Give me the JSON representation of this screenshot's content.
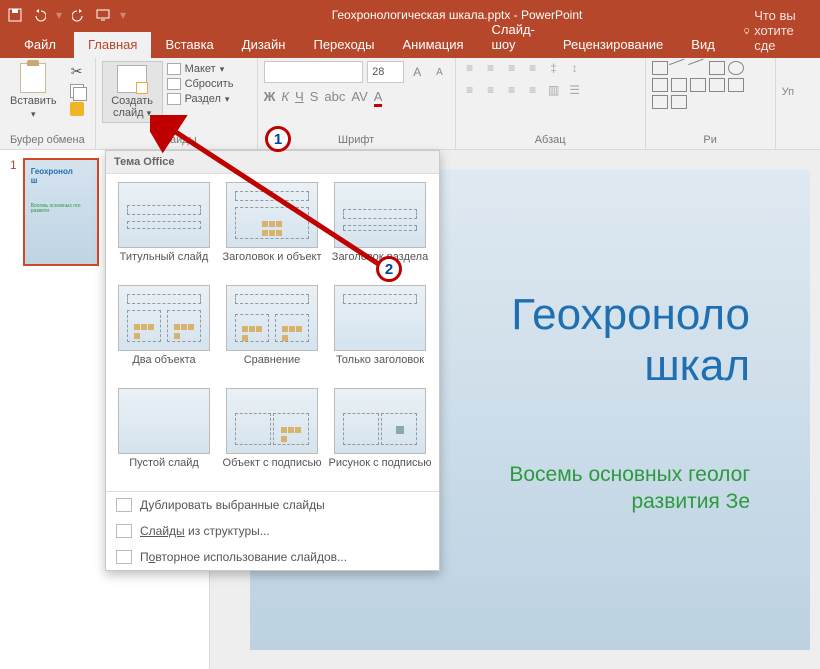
{
  "titlebar": {
    "title": "Геохронологическая шкала.pptx - PowerPoint"
  },
  "tabs": {
    "file": "Файл",
    "home": "Главная",
    "insert": "Вставка",
    "design": "Дизайн",
    "transitions": "Переходы",
    "animations": "Анимация",
    "slideshow": "Слайд-шоу",
    "review": "Рецензирование",
    "view": "Вид",
    "tellme": "Что вы хотите сде"
  },
  "ribbon": {
    "clipboard": {
      "paste": "Вставить",
      "label": "Буфер обмена"
    },
    "slides": {
      "new": "Создать\nслайд",
      "layout": "Макет",
      "reset": "Сбросить",
      "section": "Раздел",
      "label": "Слайды"
    },
    "font": {
      "size": "28",
      "label": "Шрифт",
      "b": "Ж",
      "i": "К",
      "u": "Ч",
      "s": "S"
    },
    "paragraph": {
      "label": "Абзац"
    },
    "drawing": {
      "label": "Ри"
    }
  },
  "gallery": {
    "header": "Тема Office",
    "items": [
      "Титульный слайд",
      "Заголовок и объект",
      "Заголовок раздела",
      "Два объекта",
      "Сравнение",
      "Только заголовок",
      "Пустой слайд",
      "Объект с подписью",
      "Рисунок с подписью"
    ],
    "footer": {
      "dup": "Дублировать выбранные слайды",
      "outline_a": "Слайды",
      "outline_b": " из структуры...",
      "reuse_a": "П",
      "reuse_b": "о",
      "reuse_c": "вторное использование слайдов..."
    }
  },
  "thumb": {
    "num": "1",
    "title": "Геохронол\nш",
    "sub": "Восемь основных гео\nразвити"
  },
  "slide": {
    "title": "Геохроноло\nшкал",
    "subtitle": "Восемь основных геолог\nразвития Зе"
  },
  "badges": {
    "one": "1",
    "two": "2"
  }
}
